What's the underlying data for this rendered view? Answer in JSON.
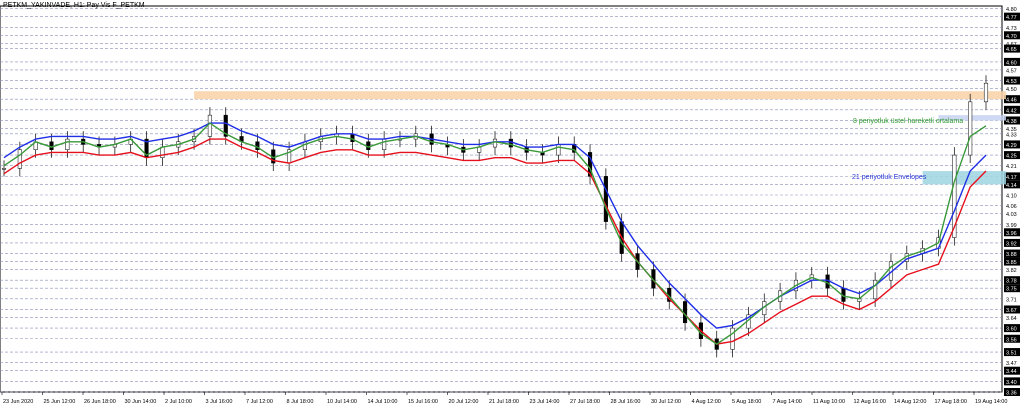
{
  "header": {
    "title": "PETKM_YAKINVADE, H1:  Pay Vis F_PETKM"
  },
  "colors": {
    "grid": "#8a8fb5",
    "candles": "#000000",
    "ema8": "#3a9a3a",
    "env_upper": "#1f2fe6",
    "env_lower": "#e6101d",
    "zone_orange": "#f8d1a6",
    "zone_blue_light": "#c7d2f2",
    "zone_cyan": "#9fd5e0",
    "label_green": "#2f9a2f",
    "label_blue": "#2b37d8",
    "price_box": "#000000"
  },
  "annotations": {
    "ema_label": "8 periyotluk üstel hareketli ortalama",
    "env_label": "21 periyotluk Envelopes"
  },
  "chart_data": {
    "type": "line",
    "title": "PETKM_YAKINVADE, H1:  Pay Vis F_PETKM",
    "xlabel": "",
    "ylabel": "",
    "ylim": [
      3.36,
      4.81
    ],
    "y_ticks": [
      "4.80",
      "4.77",
      "4.73",
      "4.70",
      "4.67",
      "4.65",
      "4.60",
      "4.57",
      "4.53",
      "4.50",
      "4.46",
      "4.42",
      "4.38",
      "4.35",
      "4.33",
      "4.29",
      "4.25",
      "4.21",
      "4.17",
      "4.14",
      "4.10",
      "4.06",
      "4.03",
      "3.99",
      "3.96",
      "3.92",
      "3.88",
      "3.85",
      "3.82",
      "3.78",
      "3.75",
      "3.71",
      "3.67",
      "3.64",
      "3.60",
      "3.56",
      "3.51",
      "3.47",
      "3.44",
      "3.40",
      "3.36"
    ],
    "highlighted_prices": [
      "4.77",
      "4.70",
      "4.65",
      "4.60",
      "4.53",
      "4.46",
      "4.42",
      "4.38",
      "4.29",
      "4.25",
      "4.17",
      "4.14",
      "3.96",
      "3.92",
      "3.88",
      "3.85",
      "3.78",
      "3.75",
      "3.67",
      "3.60",
      "3.56",
      "3.51",
      "3.44",
      "3.40",
      "3.36"
    ],
    "x_ticks": [
      "23 Jun 2020",
      "25 Jun 12:00",
      "26 Jun 18:00",
      "30 Jun 14:00",
      "2 Jul 10:00",
      "3 Jul 16:00",
      "7 Jul 12:00",
      "8 Jul 18:00",
      "10 Jul 14:00",
      "14 Jul 10:00",
      "15 Jul 16:00",
      "20 Jul 12:00",
      "21 Jul 18:00",
      "23 Jul 14:00",
      "27 Jul 18:00",
      "28 Jul 16:00",
      "30 Jul 12:00",
      "4 Aug 12:00",
      "5 Aug 18:00",
      "7 Aug 14:00",
      "11 Aug 10:00",
      "12 Aug 16:00",
      "14 Aug 12:00",
      "17 Aug 18:00",
      "19 Aug 14:00"
    ],
    "series": [
      {
        "name": "8 periyotluk üstel hareketli ortalama",
        "values": [
          4.21,
          4.25,
          4.3,
          4.28,
          4.3,
          4.3,
          4.28,
          4.29,
          4.31,
          4.25,
          4.28,
          4.29,
          4.31,
          4.37,
          4.33,
          4.3,
          4.28,
          4.24,
          4.26,
          4.29,
          4.31,
          4.32,
          4.31,
          4.28,
          4.3,
          4.31,
          4.32,
          4.3,
          4.29,
          4.27,
          4.28,
          4.3,
          4.29,
          4.27,
          4.26,
          4.28,
          4.27,
          4.2,
          4.05,
          3.92,
          3.85,
          3.78,
          3.72,
          3.65,
          3.58,
          3.54,
          3.58,
          3.63,
          3.68,
          3.72,
          3.76,
          3.79,
          3.77,
          3.72,
          3.71,
          3.76,
          3.83,
          3.87,
          3.89,
          3.92,
          4.15,
          4.32,
          4.36
        ]
      },
      {
        "name": "21 periyotluk Envelopes",
        "values": [
          4.24,
          4.28,
          4.31,
          4.32,
          4.32,
          4.32,
          4.31,
          4.31,
          4.32,
          4.3,
          4.31,
          4.32,
          4.34,
          4.37,
          4.37,
          4.34,
          4.32,
          4.29,
          4.28,
          4.3,
          4.32,
          4.33,
          4.33,
          4.31,
          4.31,
          4.32,
          4.32,
          4.31,
          4.3,
          4.29,
          4.29,
          4.3,
          4.3,
          4.28,
          4.28,
          4.29,
          4.29,
          4.24,
          4.12,
          4.0,
          3.91,
          3.84,
          3.77,
          3.71,
          3.65,
          3.6,
          3.61,
          3.64,
          3.68,
          3.72,
          3.75,
          3.78,
          3.78,
          3.75,
          3.73,
          3.76,
          3.81,
          3.86,
          3.88,
          3.9,
          4.04,
          4.19,
          4.25
        ]
      },
      {
        "name": "",
        "values": [
          4.18,
          4.22,
          4.25,
          4.26,
          4.26,
          4.26,
          4.25,
          4.25,
          4.26,
          4.24,
          4.25,
          4.26,
          4.28,
          4.31,
          4.31,
          4.28,
          4.26,
          4.23,
          4.22,
          4.24,
          4.26,
          4.27,
          4.27,
          4.25,
          4.25,
          4.26,
          4.26,
          4.25,
          4.24,
          4.23,
          4.23,
          4.24,
          4.24,
          4.22,
          4.22,
          4.23,
          4.23,
          4.18,
          4.06,
          3.94,
          3.85,
          3.78,
          3.71,
          3.65,
          3.59,
          3.54,
          3.55,
          3.58,
          3.62,
          3.66,
          3.69,
          3.72,
          3.72,
          3.69,
          3.67,
          3.7,
          3.75,
          3.8,
          3.82,
          3.84,
          3.98,
          4.13,
          4.19
        ]
      },
      {
        "name": "candles_close",
        "values": [
          4.2,
          4.27,
          4.3,
          4.27,
          4.31,
          4.29,
          4.28,
          4.29,
          4.31,
          4.24,
          4.28,
          4.3,
          4.32,
          4.4,
          4.32,
          4.3,
          4.27,
          4.22,
          4.27,
          4.3,
          4.32,
          4.33,
          4.3,
          4.27,
          4.31,
          4.31,
          4.33,
          4.29,
          4.28,
          4.26,
          4.28,
          4.31,
          4.28,
          4.26,
          4.25,
          4.29,
          4.26,
          4.17,
          4.0,
          3.88,
          3.82,
          3.75,
          3.7,
          3.62,
          3.56,
          3.52,
          3.6,
          3.65,
          3.7,
          3.74,
          3.78,
          3.8,
          3.75,
          3.7,
          3.71,
          3.78,
          3.85,
          3.88,
          3.9,
          3.94,
          4.25,
          4.45,
          4.52
        ]
      }
    ],
    "zones": [
      {
        "kind": "orange",
        "x_from_idx": 12,
        "x_to_idx": 62,
        "y": [
          4.46,
          4.49
        ]
      },
      {
        "kind": "blue_light",
        "x_from_idx": 59,
        "x_to_idx": 62,
        "y": [
          4.38,
          4.4
        ]
      },
      {
        "kind": "cyan",
        "x_from_idx": 58,
        "x_to_idx": 62,
        "y": [
          4.14,
          4.19
        ]
      }
    ]
  }
}
